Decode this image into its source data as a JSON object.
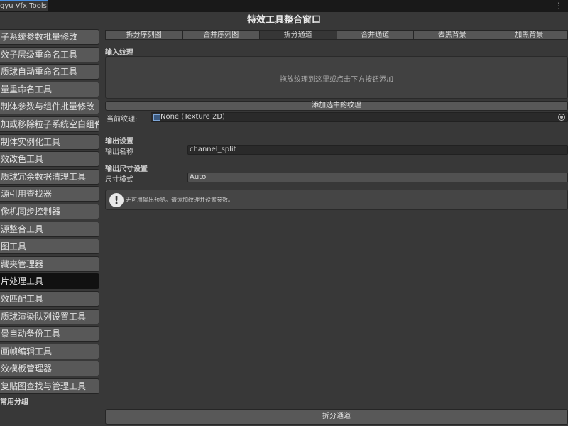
{
  "window": {
    "tab_title": "gyu Vfx Tools",
    "menu_icon": "kebab-menu-icon",
    "title": "特效工具整合窗口"
  },
  "sidebar": {
    "items": [
      "子系统参数批量修改",
      "效子层级重命名工具",
      "质球自动重命名工具",
      "量重命名工具",
      "制体参数与组件批量修改",
      "加或移除粒子系统空白组件",
      "制体实例化工具",
      "效改色工具",
      "质球冗余数据清理工具",
      "源引用查找器",
      "像机同步控制器",
      "源整合工具",
      "图工具",
      "藏夹管理器",
      "片处理工具",
      "效匹配工具",
      "质球渲染队列设置工具",
      "景自动备份工具",
      "画帧编辑工具",
      "效模板管理器",
      "复贴图查找与管理工具"
    ],
    "active_index": 14,
    "group_label": "常用分组"
  },
  "tabs": [
    "拆分序列图",
    "合并序列图",
    "拆分通道",
    "合并通道",
    "去黑背景",
    "加黑背景"
  ],
  "active_tab": 2,
  "input": {
    "section_label": "输入纹理",
    "dropzone_text": "拖放纹理到这里或点击下方按钮添加",
    "add_button": "添加选中的纹理",
    "current_label": "当前纹理:",
    "current_value": "None (Texture 2D)"
  },
  "output": {
    "section_label": "输出设置",
    "name_label": "输出名称",
    "name_value": "channel_split",
    "size_section_label": "输出尺寸设置",
    "size_mode_label": "尺寸模式",
    "size_mode_value": "Auto"
  },
  "help": {
    "icon": "warning-icon",
    "text": "无可用输出预览。请添加纹理并设置参数。"
  },
  "action_button": "拆分通道",
  "colors": {
    "background": "#383838",
    "active_item": "#111111",
    "button": "#585858",
    "tab_accent": "#4a90e2"
  }
}
